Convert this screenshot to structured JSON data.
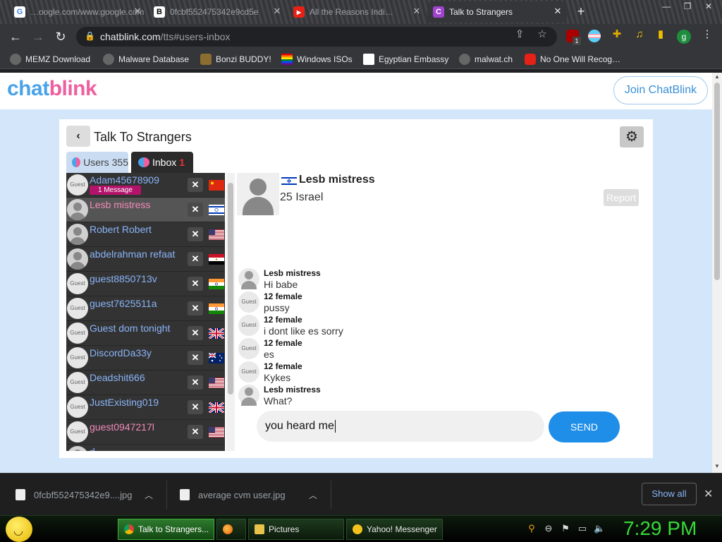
{
  "browser": {
    "tabs": [
      {
        "label": "…oogle.com/www.google.com",
        "active": false
      },
      {
        "label": "0fcbf552475342e9cd5e",
        "active": false
      },
      {
        "label": "All the Reasons Indi…",
        "active": false
      },
      {
        "label": "Talk to Strangers",
        "active": true
      }
    ],
    "url_host": "chatblink.com",
    "url_path": "/tts#users-inbox",
    "profile_initial": "g",
    "ext_badge": "1",
    "bookmarks": [
      "MEMZ Download",
      "Malware Database",
      "Bonzi BUDDY!",
      "Windows ISOs",
      "Egyptian Embassy",
      "malwat.ch",
      "No One Will Recog…"
    ]
  },
  "site": {
    "logo_a": "chat",
    "logo_b": "blink",
    "join_label": "Join ChatBlink"
  },
  "panel": {
    "title": "Talk To Strangers",
    "users_tab_label": "Users",
    "users_count": "355",
    "inbox_tab_label": "Inbox",
    "inbox_count": "1"
  },
  "users": [
    {
      "name": "Adam45678909",
      "avatar": "Guest",
      "badge": "1 Message",
      "flag": "cn",
      "pink": false,
      "selected": false
    },
    {
      "name": "Lesb mistress",
      "avatar": "",
      "badge": "",
      "flag": "il",
      "pink": true,
      "selected": true
    },
    {
      "name": "Robert Robert",
      "avatar": "",
      "badge": "",
      "flag": "us",
      "pink": false,
      "selected": false
    },
    {
      "name": "abdelrahman refaat",
      "avatar": "",
      "badge": "",
      "flag": "eg",
      "pink": false,
      "selected": false
    },
    {
      "name": "guest8850713v",
      "avatar": "Guest",
      "badge": "",
      "flag": "in",
      "pink": false,
      "selected": false
    },
    {
      "name": "guest7625511a",
      "avatar": "Guest",
      "badge": "",
      "flag": "in",
      "pink": false,
      "selected": false
    },
    {
      "name": "Guest dom tonight",
      "avatar": "Guest",
      "badge": "",
      "flag": "gb",
      "pink": false,
      "selected": false
    },
    {
      "name": "DiscordDa33y",
      "avatar": "Guest",
      "badge": "",
      "flag": "au",
      "pink": false,
      "selected": false
    },
    {
      "name": "Deadshit666",
      "avatar": "Guest",
      "badge": "",
      "flag": "us",
      "pink": false,
      "selected": false
    },
    {
      "name": "JustExisting019",
      "avatar": "Guest",
      "badge": "",
      "flag": "gb",
      "pink": false,
      "selected": false
    },
    {
      "name": "guest0947217l",
      "avatar": "Guest",
      "badge": "",
      "flag": "us",
      "pink": true,
      "selected": false
    },
    {
      "name": "d",
      "avatar": "",
      "badge": "",
      "flag": "",
      "pink": false,
      "selected": false
    }
  ],
  "conversation": {
    "name": "Lesb mistress",
    "meta": "25 Israel",
    "report_label": "Report",
    "messages": [
      {
        "sender": "Lesb mistress",
        "text": "Hi babe",
        "avatar": ""
      },
      {
        "sender": "12 female",
        "text": "pussy",
        "avatar": "Guest"
      },
      {
        "sender": "12 female",
        "text": "i dont like es sorry",
        "avatar": "Guest"
      },
      {
        "sender": "12 female",
        "text": "es",
        "avatar": "Guest"
      },
      {
        "sender": "12 female",
        "text": "Kykes",
        "avatar": "Guest"
      },
      {
        "sender": "Lesb mistress",
        "text": "What?",
        "avatar": ""
      }
    ],
    "input_value": "you heard me",
    "send_label": "SEND"
  },
  "downloads": {
    "items": [
      "0fcbf552475342e9....jpg",
      "average cvm user.jpg"
    ],
    "show_all_label": "Show all"
  },
  "taskbar": {
    "tasks": [
      "Talk to Strangers...",
      "",
      "Pictures",
      "Yahoo! Messenger"
    ],
    "clock": "7:29 PM"
  }
}
